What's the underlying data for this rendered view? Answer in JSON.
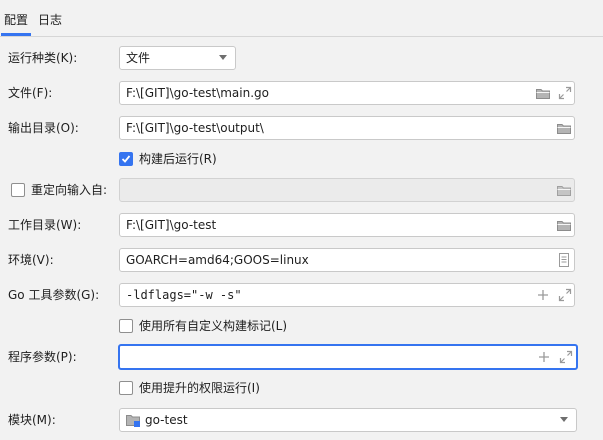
{
  "tabs": [
    {
      "label": "配置",
      "active": true
    },
    {
      "label": "日志",
      "active": false
    }
  ],
  "run_kind": {
    "label": "运行种类(K):",
    "value": "文件"
  },
  "file": {
    "label": "文件(F):",
    "value": "F:\\[GIT]\\go-test\\main.go",
    "icons": [
      "folder-icon",
      "expand-icon"
    ]
  },
  "output_dir": {
    "label": "输出目录(O):",
    "value": "F:\\[GIT]\\go-test\\output\\",
    "icons": [
      "folder-icon"
    ]
  },
  "run_after_build": {
    "label": "构建后运行(R)",
    "checked": true
  },
  "redirect_input": {
    "label": "重定向输入自:",
    "checked": false,
    "value": "",
    "icons": [
      "folder-icon"
    ]
  },
  "working_dir": {
    "label": "工作目录(W):",
    "value": "F:\\[GIT]\\go-test",
    "icons": [
      "folder-icon"
    ]
  },
  "environment": {
    "label": "环境(V):",
    "value": "GOARCH=amd64;GOOS=linux",
    "icons": [
      "document-icon"
    ]
  },
  "go_tool_args": {
    "label": "Go 工具参数(G):",
    "value": "-ldflags=\"-w -s\"",
    "icons": [
      "plus-icon",
      "expand-icon"
    ]
  },
  "use_custom_tags": {
    "label": "使用所有自定义构建标记(L)",
    "checked": false
  },
  "program_args": {
    "label": "程序参数(P):",
    "value": "",
    "focused": true,
    "icons": [
      "plus-icon",
      "expand-icon"
    ]
  },
  "elevated": {
    "label": "使用提升的权限运行(I)",
    "checked": false
  },
  "module": {
    "label": "模块(M):",
    "value": "go-test",
    "icons": [
      "module-folder-icon"
    ]
  },
  "colors": {
    "accent": "#3574f0",
    "background": "#f2f2f2",
    "field_border": "#c9c9c9",
    "icon": "#9a9a9a"
  }
}
